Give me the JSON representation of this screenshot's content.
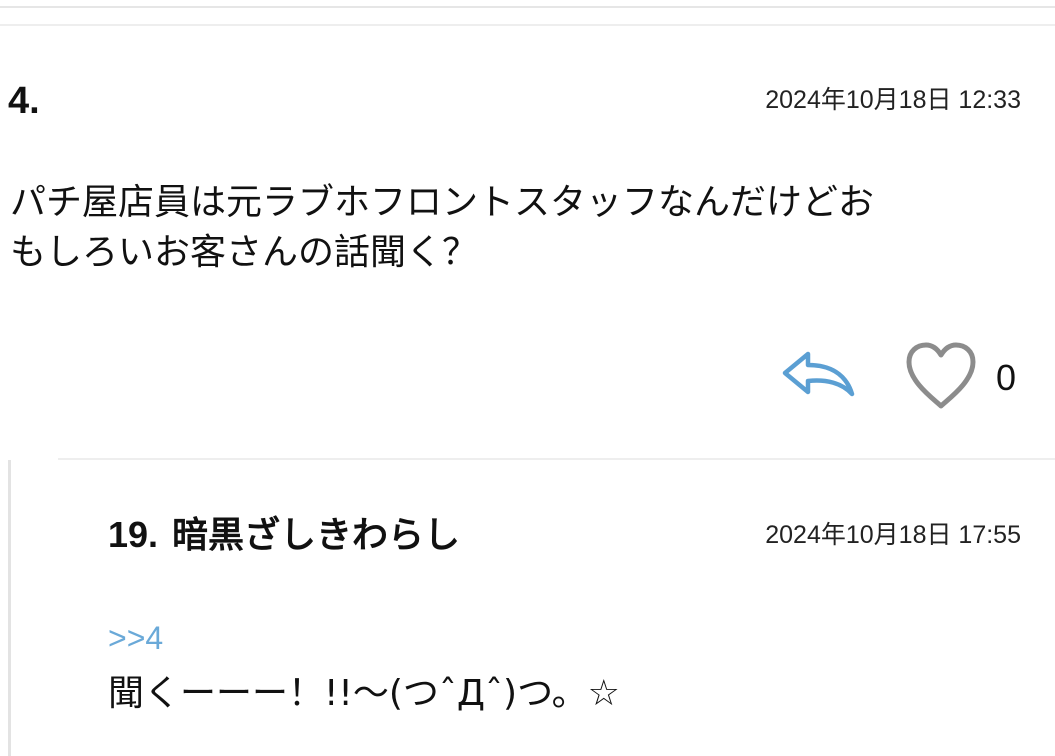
{
  "comment": {
    "number": "4.",
    "timestamp": "2024年10月18日 12:33",
    "body_line1": "パチ屋店員は元ラブホフロントスタッフなんだけどお",
    "body_line2": "もしろいお客さんの話聞く？",
    "like_count": "0"
  },
  "reply": {
    "number": "19.",
    "author": "暗黒ざしきわらし",
    "timestamp": "2024年10月18日 17:55",
    "anchor": ">>4",
    "body": "聞くーーー！!!〜(つˆДˆ)つ。☆"
  },
  "icons": {
    "reply": "reply-arrow-icon",
    "like": "heart-outline-icon"
  },
  "colors": {
    "reply_icon": "#5b9fd3",
    "heart_icon": "#8c8c8c",
    "anchor_link": "#6aa9d8"
  }
}
